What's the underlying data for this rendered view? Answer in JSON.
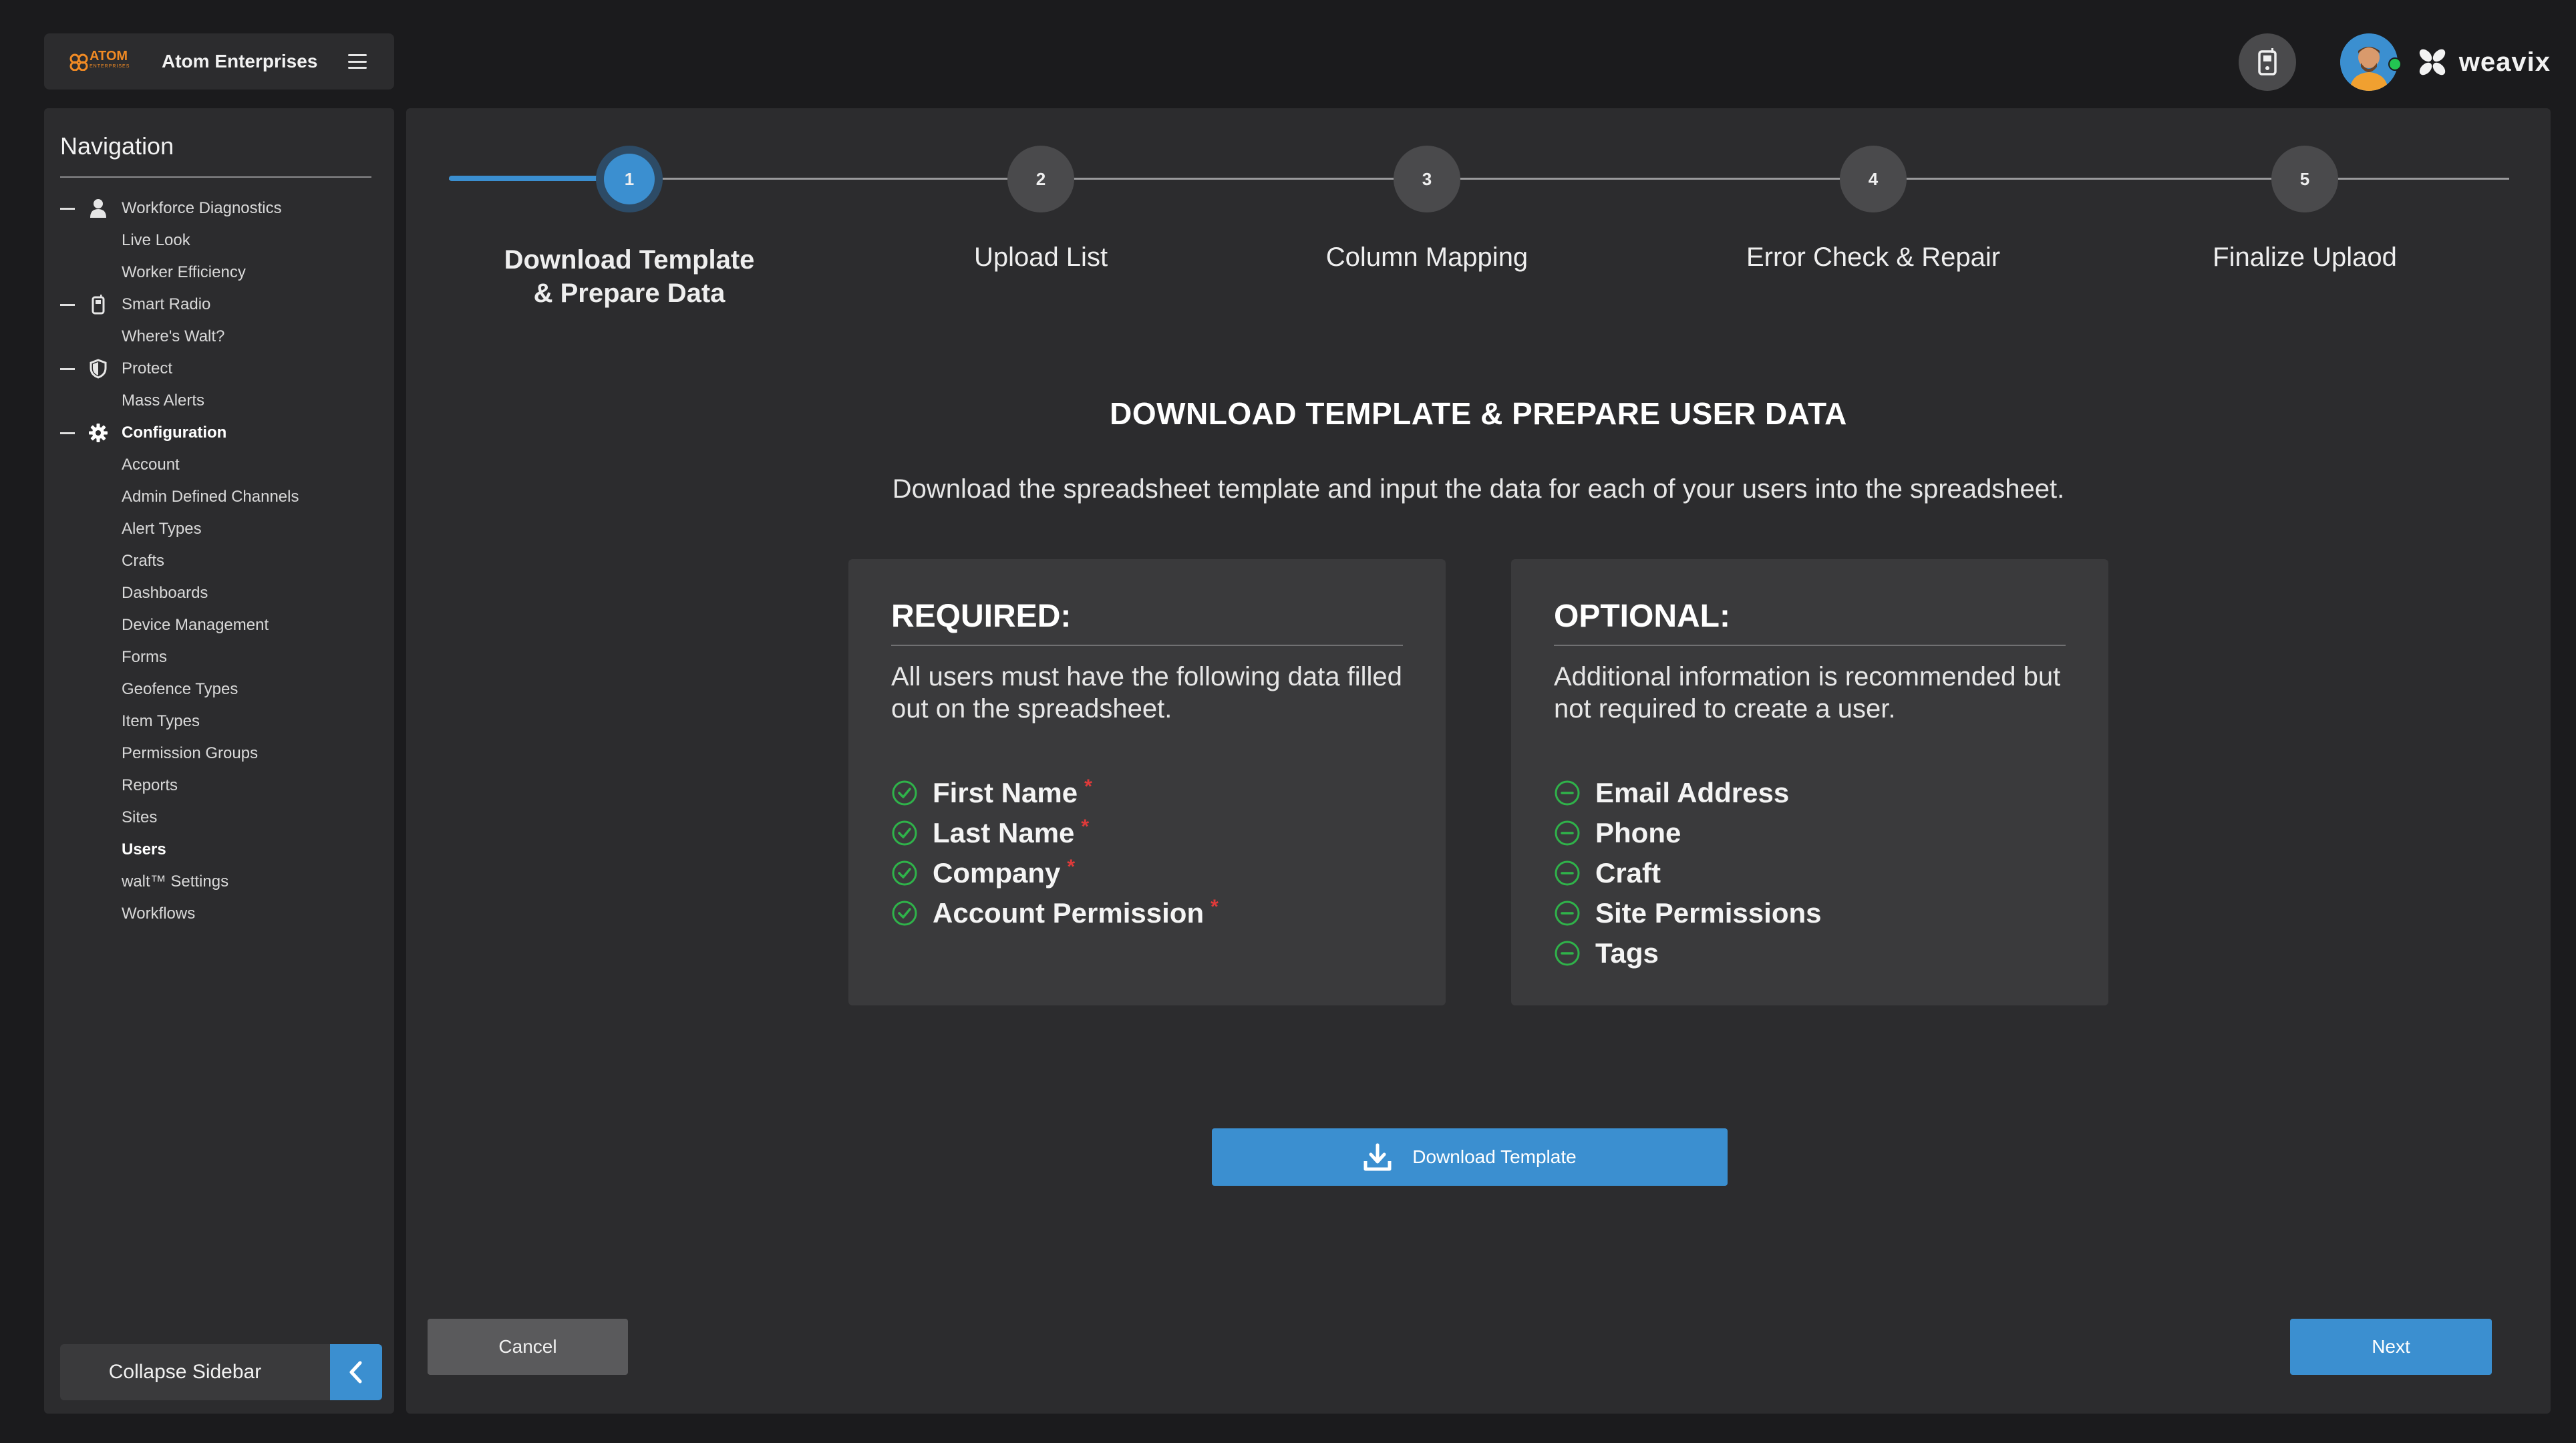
{
  "header": {
    "logo_text": "ATOM",
    "logo_subtext": "ENTERPRISES",
    "org_name": "Atom Enterprises",
    "brand": "weavix"
  },
  "sidebar": {
    "title": "Navigation",
    "items": [
      {
        "label": "Workforce Diagnostics",
        "type": "section",
        "icon": "person-icon"
      },
      {
        "label": "Live Look",
        "type": "child"
      },
      {
        "label": "Worker Efficiency",
        "type": "child"
      },
      {
        "label": "Smart Radio",
        "type": "section",
        "icon": "radio-icon"
      },
      {
        "label": "Where's Walt?",
        "type": "child"
      },
      {
        "label": "Protect",
        "type": "section",
        "icon": "shield-icon"
      },
      {
        "label": "Mass Alerts",
        "type": "child"
      },
      {
        "label": "Configuration",
        "type": "section",
        "icon": "gear-icon"
      },
      {
        "label": "Account",
        "type": "child"
      },
      {
        "label": "Admin Defined Channels",
        "type": "child"
      },
      {
        "label": "Alert Types",
        "type": "child"
      },
      {
        "label": "Crafts",
        "type": "child"
      },
      {
        "label": "Dashboards",
        "type": "child"
      },
      {
        "label": "Device Management",
        "type": "child"
      },
      {
        "label": "Forms",
        "type": "child"
      },
      {
        "label": "Geofence Types",
        "type": "child"
      },
      {
        "label": "Item Types",
        "type": "child"
      },
      {
        "label": "Permission Groups",
        "type": "child"
      },
      {
        "label": "Reports",
        "type": "child"
      },
      {
        "label": "Sites",
        "type": "child"
      },
      {
        "label": "Users",
        "type": "child"
      },
      {
        "label": "walt™ Settings",
        "type": "child"
      },
      {
        "label": "Workflows",
        "type": "child"
      }
    ],
    "collapse_label": "Collapse Sidebar"
  },
  "stepper": {
    "current": 1,
    "steps": [
      {
        "number": "1",
        "label": "Download Template\n& Prepare Data"
      },
      {
        "number": "2",
        "label": "Upload List"
      },
      {
        "number": "3",
        "label": "Column Mapping"
      },
      {
        "number": "4",
        "label": "Error Check & Repair"
      },
      {
        "number": "5",
        "label": "Finalize Uplaod"
      }
    ]
  },
  "content": {
    "title": "DOWNLOAD TEMPLATE & PREPARE USER DATA",
    "description": "Download the spreadsheet template and input the data for each of your users into the spreadsheet."
  },
  "required_card": {
    "title": "REQUIRED:",
    "description": "All users must have the following data filled out on the spreadsheet.",
    "fields": [
      "First Name",
      "Last Name",
      "Company",
      "Account Permission"
    ],
    "marker": "*"
  },
  "optional_card": {
    "title": "OPTIONAL:",
    "description": "Additional information is recommended but not required to create a user.",
    "fields": [
      "Email Address",
      "Phone",
      "Craft",
      "Site Permissions",
      "Tags"
    ]
  },
  "actions": {
    "download_label": "Download Template",
    "cancel_label": "Cancel",
    "next_label": "Next"
  },
  "colors": {
    "accent": "#3b8fd0",
    "success": "#2fb34a",
    "required": "#e03a3a"
  }
}
